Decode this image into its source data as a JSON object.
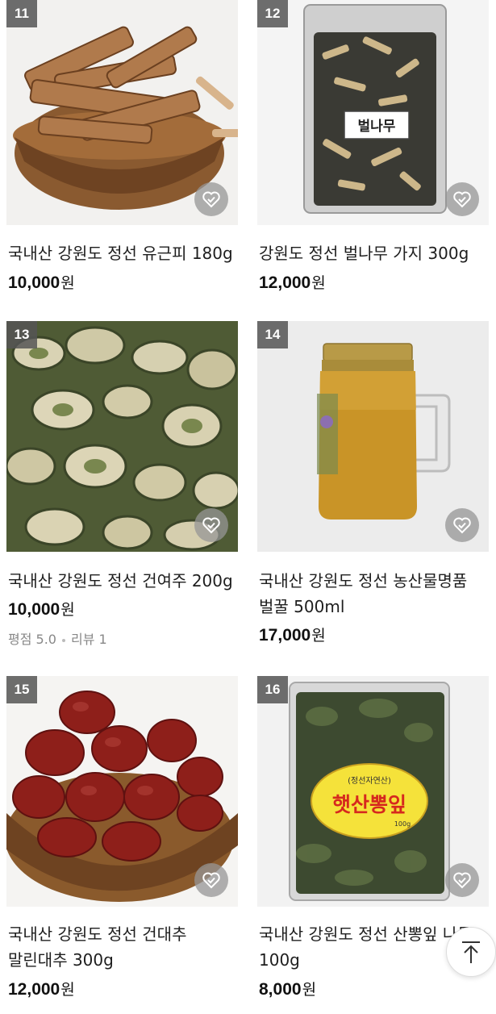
{
  "products": [
    {
      "rank": "11",
      "name": "국내산 강원도 정선 유근피 180g",
      "name2": "",
      "price": "10,000",
      "currency": "원"
    },
    {
      "rank": "12",
      "name": "강원도 정선 벌나무 가지 300g",
      "name2": "",
      "price": "12,000",
      "currency": "원",
      "package_label": "벌나무"
    },
    {
      "rank": "13",
      "name": "국내산 강원도 정선 건여주 200g",
      "name2": "",
      "price": "10,000",
      "currency": "원",
      "rating_label": "평점 5.0",
      "review_label": "리뷰 1"
    },
    {
      "rank": "14",
      "name": "국내산 강원도 정선 농산물명품",
      "name2": "벌꿀 500ml",
      "price": "17,000",
      "currency": "원"
    },
    {
      "rank": "15",
      "name": "국내산 강원도 정선 건대추",
      "name2": "말린대추 300g",
      "price": "12,000",
      "currency": "원"
    },
    {
      "rank": "16",
      "name": "국내산 강원도 정선 산뽕잎 나물",
      "name2": "100g",
      "price": "8,000",
      "currency": "원",
      "package_label_small": "(정선자연산)",
      "package_label_big": "햇산뽕잎",
      "package_weight": "100g"
    }
  ],
  "icons": {
    "wishlist": "heart-check-icon",
    "scroll_top": "arrow-up-icon"
  },
  "colors": {
    "badge": "#555555",
    "text": "#1e1e1e",
    "muted": "#888888"
  }
}
